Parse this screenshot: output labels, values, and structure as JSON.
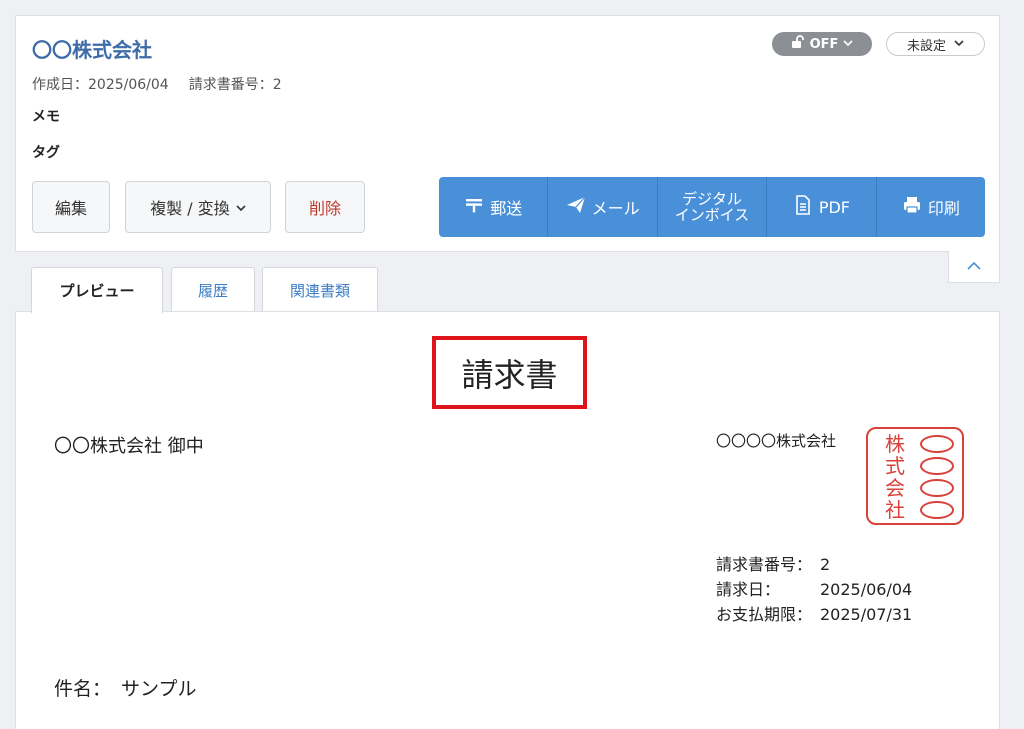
{
  "header": {
    "company_name": "〇〇株式会社",
    "created_label": "作成日：2025/06/04",
    "invoice_number_label": "請求書番号：2",
    "memo_label": "メモ",
    "tag_label": "タグ",
    "lock_toggle": {
      "label": "OFF",
      "icon": "unlock-icon"
    },
    "status_select": {
      "value": "未設定"
    }
  },
  "buttons": {
    "edit": "編集",
    "copy_convert": "複製 / 変換",
    "delete": "削除"
  },
  "actions": [
    {
      "label": "郵送",
      "icon": "postal-mark-icon"
    },
    {
      "label": "メール",
      "icon": "paper-plane-icon"
    },
    {
      "label_line1": "デジタル",
      "label_line2": "インボイス"
    },
    {
      "label": "PDF",
      "icon": "document-icon"
    },
    {
      "label": "印刷",
      "icon": "printer-icon"
    }
  ],
  "tabs": [
    {
      "label": "プレビュー",
      "active": true
    },
    {
      "label": "履歴"
    },
    {
      "label": "関連書類"
    }
  ],
  "document": {
    "title": "請求書",
    "recipient": "〇〇株式会社 御中",
    "issuer": "〇〇〇〇株式会社",
    "seal": {
      "chars": [
        "株",
        "式",
        "会",
        "社"
      ],
      "color": "#d9423a"
    },
    "info": [
      {
        "key": "請求書番号：",
        "value": "2"
      },
      {
        "key": "請求日：",
        "value": "2025/06/04"
      },
      {
        "key": "お支払期限：",
        "value": "2025/07/31"
      }
    ],
    "subject_label": "件名：",
    "subject_value": "サンプル"
  },
  "colors": {
    "accent": "#4a90d9",
    "title_link": "#3e6ca8",
    "delete": "#c0392b",
    "highlight_box": "#e0121a"
  }
}
